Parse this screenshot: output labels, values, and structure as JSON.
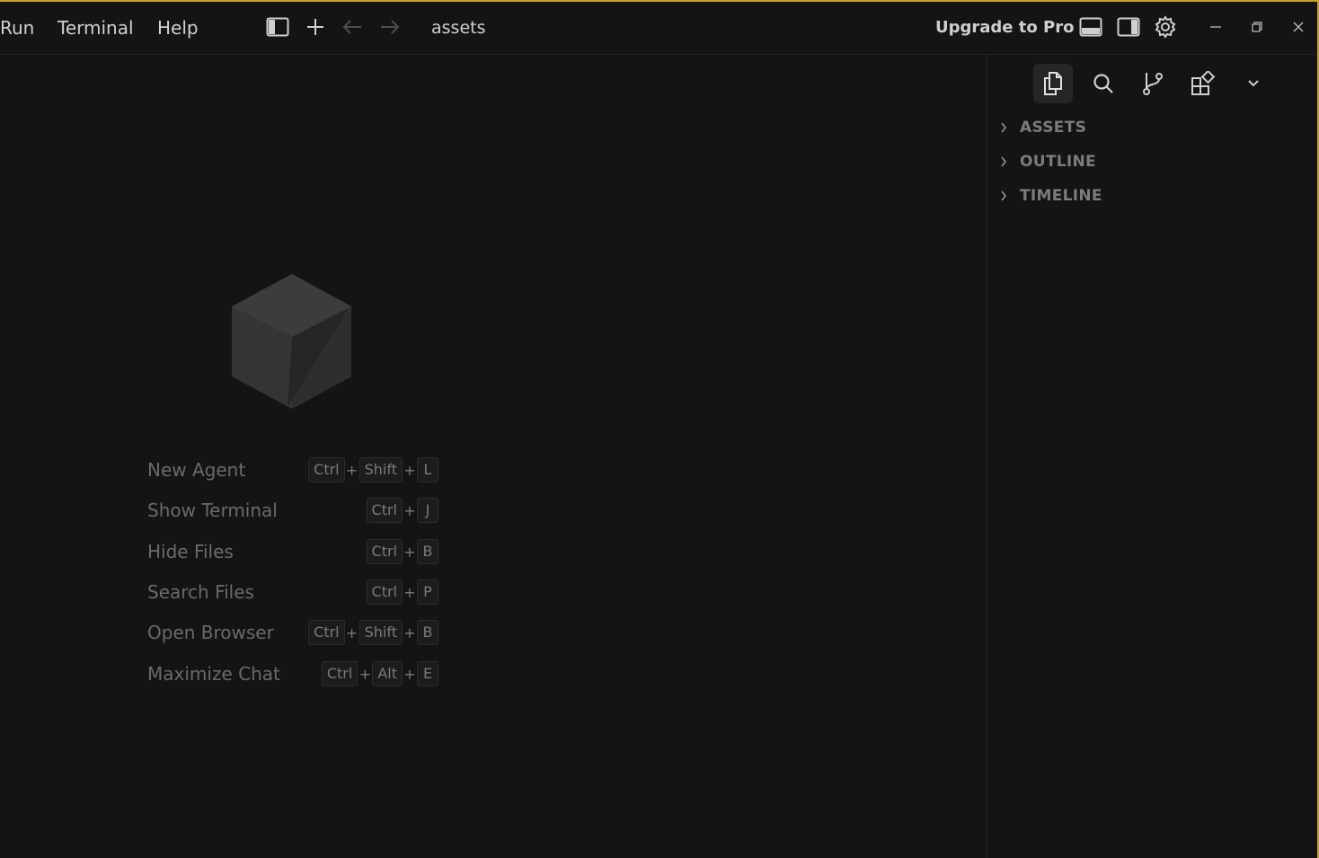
{
  "menu": {
    "items": [
      "Run",
      "Terminal",
      "Help"
    ]
  },
  "titlebar": {
    "folder_name": "assets",
    "upgrade_label": "Upgrade to Pro"
  },
  "welcome": {
    "shortcuts": [
      {
        "label": "New Agent",
        "keys": [
          "Ctrl",
          "Shift",
          "L"
        ]
      },
      {
        "label": "Show Terminal",
        "keys": [
          "Ctrl",
          "J"
        ]
      },
      {
        "label": "Hide Files",
        "keys": [
          "Ctrl",
          "B"
        ]
      },
      {
        "label": "Search Files",
        "keys": [
          "Ctrl",
          "P"
        ]
      },
      {
        "label": "Open Browser",
        "keys": [
          "Ctrl",
          "Shift",
          "B"
        ]
      },
      {
        "label": "Maximize Chat",
        "keys": [
          "Ctrl",
          "Alt",
          "E"
        ]
      }
    ],
    "key_separator": "+"
  },
  "sidebar": {
    "sections": [
      "ASSETS",
      "OUTLINE",
      "TIMELINE"
    ]
  },
  "colors": {
    "accent_border": "#c9a227",
    "background": "#141414"
  }
}
